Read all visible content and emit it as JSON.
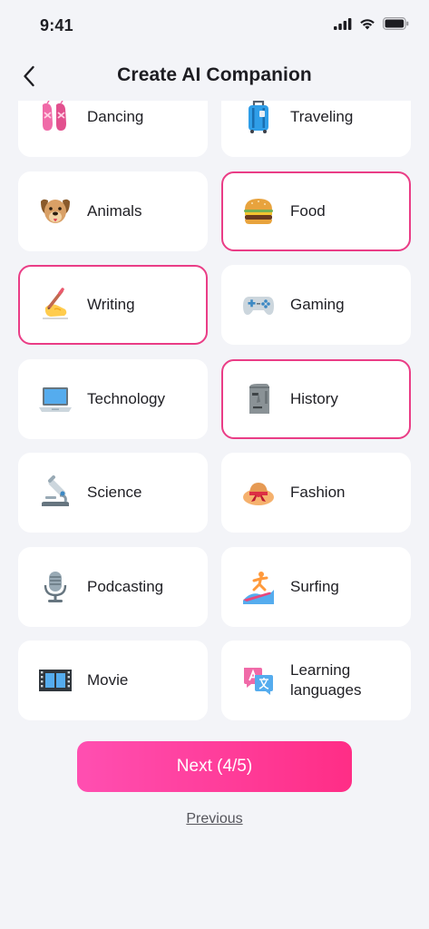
{
  "status_bar": {
    "time": "9:41"
  },
  "header": {
    "title": "Create AI Companion",
    "back_icon": "chevron-left-icon"
  },
  "interests": [
    {
      "label": "Dancing",
      "icon": "ballet-shoes-icon",
      "selected": false
    },
    {
      "label": "Traveling",
      "icon": "luggage-icon",
      "selected": false
    },
    {
      "label": "Animals",
      "icon": "dog-face-icon",
      "selected": false
    },
    {
      "label": "Food",
      "icon": "hamburger-icon",
      "selected": true
    },
    {
      "label": "Writing",
      "icon": "writing-hand-icon",
      "selected": true
    },
    {
      "label": "Gaming",
      "icon": "game-controller-icon",
      "selected": false
    },
    {
      "label": "Technology",
      "icon": "laptop-icon",
      "selected": false
    },
    {
      "label": "History",
      "icon": "moai-icon",
      "selected": true
    },
    {
      "label": "Science",
      "icon": "microscope-icon",
      "selected": false
    },
    {
      "label": "Fashion",
      "icon": "womans-hat-icon",
      "selected": false
    },
    {
      "label": "Podcasting",
      "icon": "studio-microphone-icon",
      "selected": false
    },
    {
      "label": "Surfing",
      "icon": "surfer-icon",
      "selected": false
    },
    {
      "label": "Movie",
      "icon": "film-frames-icon",
      "selected": false
    },
    {
      "label": "Learning languages",
      "icon": "language-icon",
      "selected": false
    }
  ],
  "actions": {
    "next_label": "Next (4/5)",
    "previous_label": "Previous"
  },
  "colors": {
    "selected_border": "#ea3d86",
    "next_gradient_start": "#ff4fb1",
    "next_gradient_end": "#ff2d86",
    "background": "#f3f4f8"
  }
}
